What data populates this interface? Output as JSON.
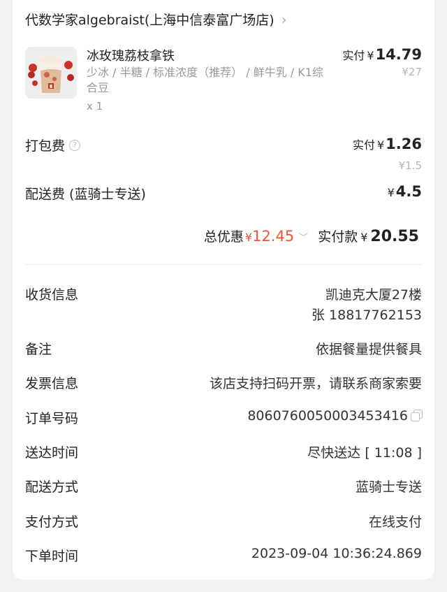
{
  "shop": {
    "name": "代数学家algebraist(上海中信泰富广场店)",
    "chevron_icon": "chevron-right-icon"
  },
  "product": {
    "name": "冰玫瑰荔枝拿铁",
    "spec": "少冰 / 半糖 / 标准浓度（推荐） / 鲜牛乳 / K1综合豆",
    "qty": "x 1",
    "paid_label": "实付",
    "currency": "¥",
    "paid": "14.79",
    "original": "¥27"
  },
  "packing": {
    "label": "打包费",
    "paid_label": "实付",
    "currency": "¥",
    "paid": "1.26",
    "original": "¥1.5"
  },
  "delivery_fee": {
    "label": "配送费 (蓝骑士专送)",
    "currency": "¥",
    "value": "4.5"
  },
  "summary": {
    "discount_label": "总优惠",
    "discount_currency": "¥",
    "discount": "12.45",
    "pay_label": "实付款",
    "pay_currency": "¥",
    "pay": "20.55"
  },
  "info": {
    "address_label": "收货信息",
    "address_line1": "凯迪克大厦27楼",
    "address_line2": "张 18817762153",
    "note_label": "备注",
    "note": "依据餐量提供餐具",
    "invoice_label": "发票信息",
    "invoice": "该店支持扫码开票，请联系商家索要",
    "order_no_label": "订单号码",
    "order_no": "8060760050003453416",
    "arrival_label": "送达时间",
    "arrival": "尽快送达 [ 11:08 ]",
    "delivery_method_label": "配送方式",
    "delivery_method": "蓝骑士专送",
    "payment_label": "支付方式",
    "payment": "在线支付",
    "order_time_label": "下单时间",
    "order_time": "2023-09-04 10:36:24.869"
  },
  "colors": {
    "discount": "#ee5533",
    "background": "#f2f2f2",
    "card": "#ffffff"
  }
}
